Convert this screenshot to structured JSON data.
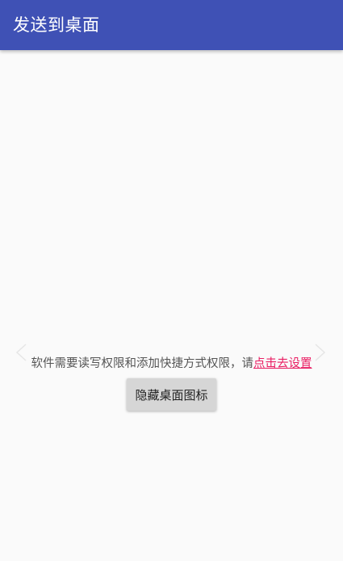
{
  "app_bar": {
    "title": "发送到桌面",
    "color": "#3f51b5"
  },
  "main": {
    "permission_text": "软件需要读写权限和添加快捷方式权限，请",
    "settings_link": "点击去设置",
    "link_color": "#e91e63",
    "hide_icon_button": "隐藏桌面图标"
  },
  "icons": {
    "left": "chevron-left-icon",
    "right": "chevron-right-icon"
  }
}
